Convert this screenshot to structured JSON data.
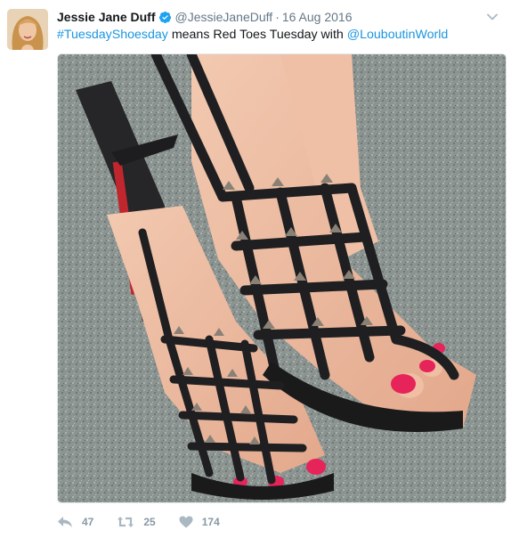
{
  "tweet": {
    "author_name": "Jessie Jane Duff",
    "author_handle": "@JessieJaneDuff",
    "separator": "·",
    "date": "16 Aug 2016",
    "text_hashtag": "#TuesdayShoesday",
    "text_middle": " means Red Toes Tuesday with ",
    "text_mention": "@LouboutinWorld"
  },
  "actions": {
    "replies": "47",
    "retweets": "25",
    "likes": "174"
  },
  "colors": {
    "link": "#1b95e0",
    "verified": "#1da1f2",
    "action_icons": "#aab8c2"
  },
  "icons": [
    "verified-badge-icon",
    "caret-down-icon",
    "reply-icon",
    "retweet-icon",
    "like-heart-icon"
  ]
}
